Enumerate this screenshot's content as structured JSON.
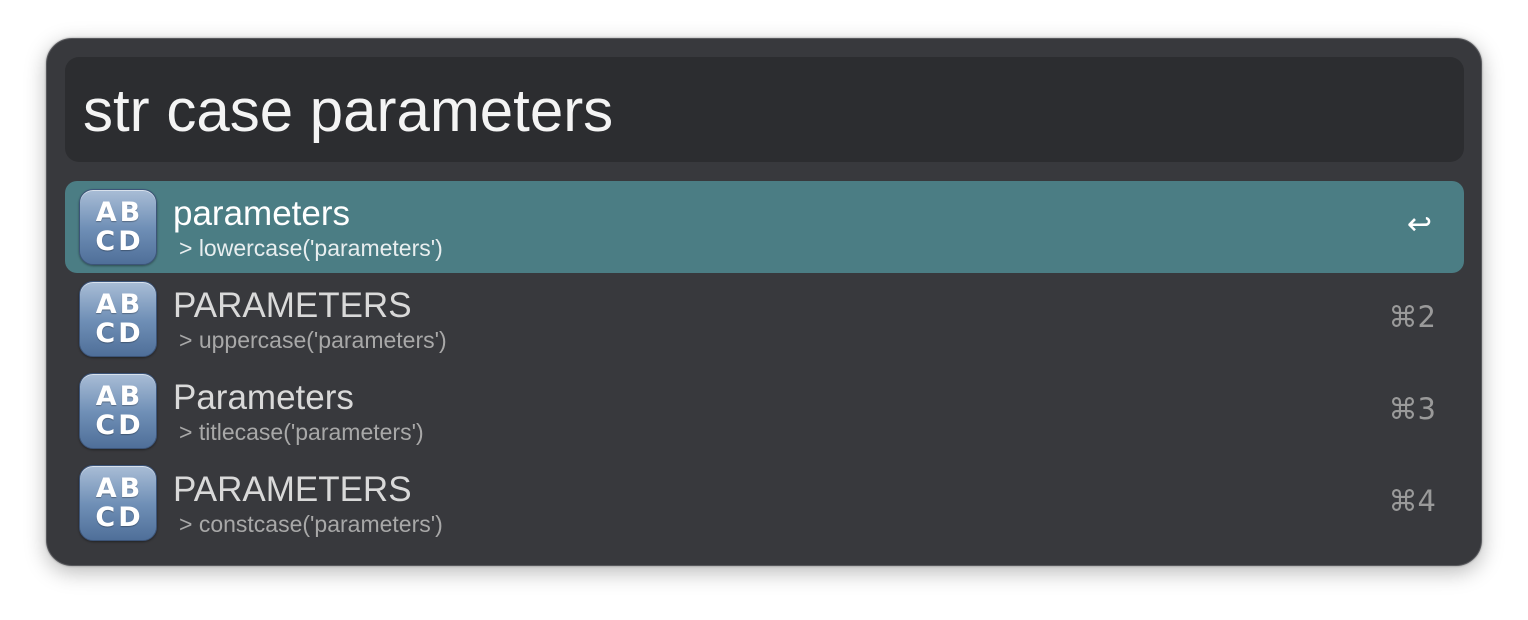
{
  "search": {
    "query": "str case parameters"
  },
  "results": [
    {
      "icon": "abcd-input-symbol-icon",
      "icon_top": "AB",
      "icon_bottom": "CD",
      "title": "parameters",
      "subtitle": "> lowercase('parameters')",
      "shortcut": "↩",
      "selected": true
    },
    {
      "icon": "abcd-input-symbol-icon",
      "icon_top": "AB",
      "icon_bottom": "CD",
      "title": "PARAMETERS",
      "subtitle": "> uppercase('parameters')",
      "shortcut": "⌘2",
      "selected": false
    },
    {
      "icon": "abcd-input-symbol-icon",
      "icon_top": "AB",
      "icon_bottom": "CD",
      "title": "Parameters",
      "subtitle": "> titlecase('parameters')",
      "shortcut": "⌘3",
      "selected": false
    },
    {
      "icon": "abcd-input-symbol-icon",
      "icon_top": "AB",
      "icon_bottom": "CD",
      "title": "PARAMETERS",
      "subtitle": "> constcase('parameters')",
      "shortcut": "⌘4",
      "selected": false
    }
  ],
  "colors": {
    "window_bg": "#38393d",
    "search_bg": "#2c2d30",
    "selected_row": "#4b7d84",
    "title_text": "#d9d9d9",
    "subtitle_text": "#a8a8a8",
    "shortcut_text": "#9a9a9a"
  }
}
